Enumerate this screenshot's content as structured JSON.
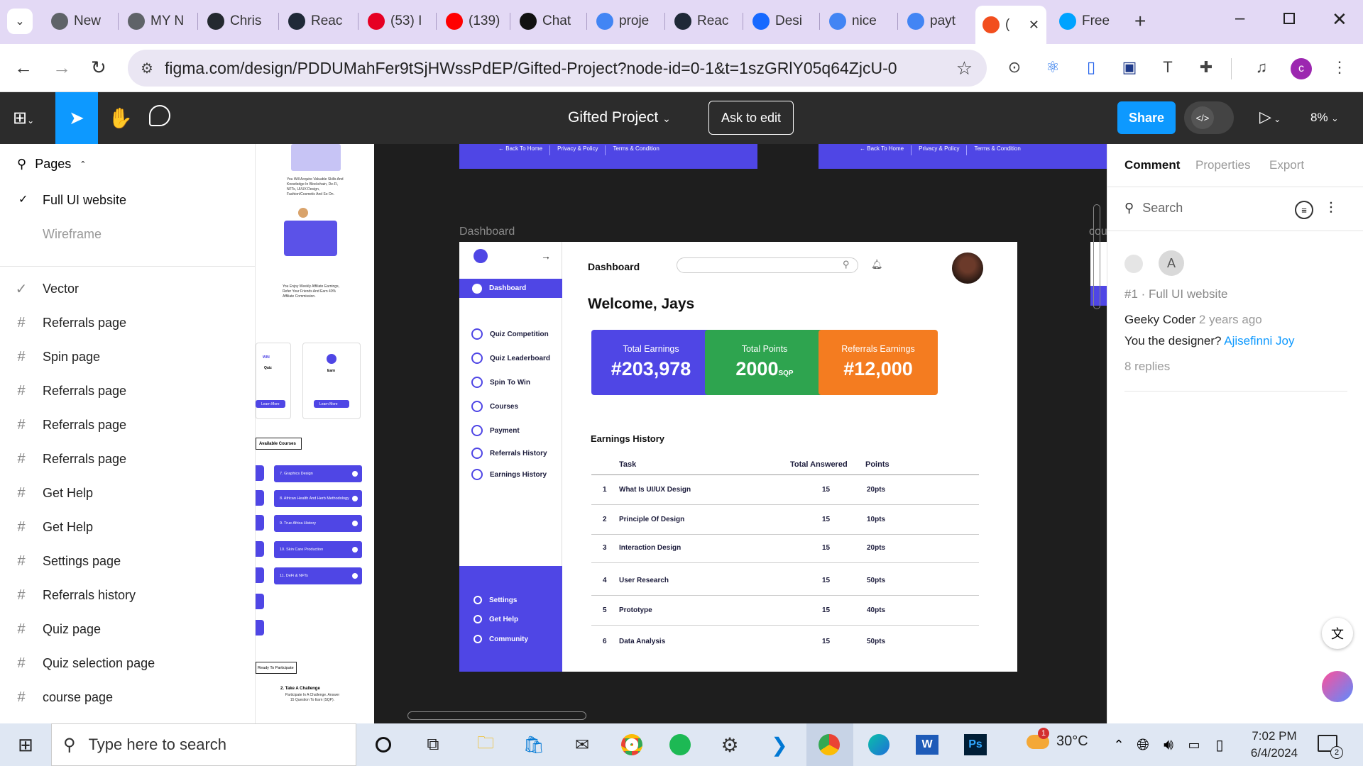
{
  "browser": {
    "tabs": [
      {
        "label": "New",
        "color": "#5f6368"
      },
      {
        "label": "MY N",
        "color": "#5f6368"
      },
      {
        "label": "Chris",
        "color": "#24292f"
      },
      {
        "label": "Reac",
        "color": "#1f2937"
      },
      {
        "label": "(53) I",
        "color": "#e60023"
      },
      {
        "label": "(139)",
        "color": "#ff0000"
      },
      {
        "label": "Chat",
        "color": "#111111"
      },
      {
        "label": "proje",
        "color": "#4285f4"
      },
      {
        "label": "Reac",
        "color": "#1f2937"
      },
      {
        "label": "Desi",
        "color": "#1769ff"
      },
      {
        "label": "nice",
        "color": "#4285f4"
      },
      {
        "label": "payt",
        "color": "#4285f4"
      },
      {
        "label": "(",
        "color": "#f24e1e"
      },
      {
        "label": "Free",
        "color": "#00a3ff"
      }
    ],
    "url": "figma.com/design/PDDUMahFer9tSjHWssPdEP/Gifted-Project?node-id=0-1&t=1szGRlY05q64ZjcU-0",
    "profile_initial": "c"
  },
  "figma": {
    "file_title": "Gifted Project",
    "ask_to_edit": "Ask to edit",
    "share": "Share",
    "zoom": "8%",
    "pages_label": "Pages",
    "pages": [
      "Full UI website",
      "Wireframe"
    ],
    "layers": [
      "Vector",
      "Referrals page",
      "Spin page",
      "Referrals page",
      "Referrals page",
      "Referrals page",
      "Get Help",
      "Get Help",
      "Settings page",
      "Referrals history",
      "Quiz page",
      "Quiz selection page",
      "course page"
    ],
    "right_tabs": [
      "Comment",
      "Properties",
      "Export"
    ],
    "search_placeholder": "Search",
    "comment": {
      "avatar_initial": "A",
      "ref": "#1 · Full UI website",
      "author": "Geeky Coder",
      "time": "2 years ago",
      "text": "You the designer?",
      "mention": "Ajisefinni Joy",
      "replies": "8 replies"
    }
  },
  "canvas": {
    "frame_label": "Dashboard",
    "frame_label_right": "cou",
    "footer_links": [
      "Back To Home",
      "Privacy & Policy",
      "Terms & Condition"
    ],
    "left_strip": {
      "para1": "You Will Acquire Valuable Skills And Knowledge In Blockchain, De-Fi, NFTs, UI/UX Design, Fashion/Cosmetic And So On.",
      "para2": "You Enjoy Weekly Affiliate Earnings, Refer Your Friends And Earn 40% Affiliate Commission.",
      "win": "WIN",
      "quiz": "Quiz",
      "earn": "Earn",
      "learn_more": "Learn More",
      "available_courses": "Available Courses",
      "courses": [
        "7. Graphics Design",
        "8. African Health And Herb Methodology",
        "9. True Africa History",
        "10. Skin Care Production",
        "11. DeFi & NFTs"
      ],
      "participate": "Ready To Participate",
      "challenge_title": "2. Take A Challenge",
      "challenge_text": "Participate In A Challenge. Answer 15 Question To Earn (SQP)."
    },
    "dashboard": {
      "title": "Dashboard",
      "welcome": "Welcome, Jays",
      "nav_active": "Dashboard",
      "nav": [
        "Quiz Competition",
        "Quiz Leaderboard",
        "Spin To Win",
        "Courses",
        "Payment",
        "Referrals History",
        "Earnings History"
      ],
      "nav_bottom": [
        "Settings",
        "Get Help",
        "Community"
      ],
      "cards": [
        {
          "label": "Total Earnings",
          "value": "#203,978",
          "unit": "",
          "color": "#4f46e5"
        },
        {
          "label": "Total Points",
          "value": "2000",
          "unit": "SQP",
          "color": "#2ea44f"
        },
        {
          "label": "Referrals Earnings",
          "value": "#12,000",
          "unit": "",
          "color": "#f47c20"
        }
      ],
      "history_title": "Earnings History",
      "columns": [
        "Task",
        "Total Answered",
        "Points"
      ],
      "rows": [
        {
          "n": "1",
          "task": "What Is UI/UX Design",
          "answered": "15",
          "points": "20pts"
        },
        {
          "n": "2",
          "task": "Principle Of Design",
          "answered": "15",
          "points": "10pts"
        },
        {
          "n": "3",
          "task": "Interaction Design",
          "answered": "15",
          "points": "20pts"
        },
        {
          "n": "4",
          "task": "User Research",
          "answered": "15",
          "points": "50pts"
        },
        {
          "n": "5",
          "task": "Prototype",
          "answered": "15",
          "points": "40pts"
        },
        {
          "n": "6",
          "task": "Data Analysis",
          "answered": "15",
          "points": "50pts"
        }
      ]
    }
  },
  "taskbar": {
    "search_placeholder": "Type here to search",
    "weather": "30°C",
    "weather_badge": "1",
    "time": "7:02 PM",
    "date": "6/4/2024",
    "notif_count": "2"
  }
}
